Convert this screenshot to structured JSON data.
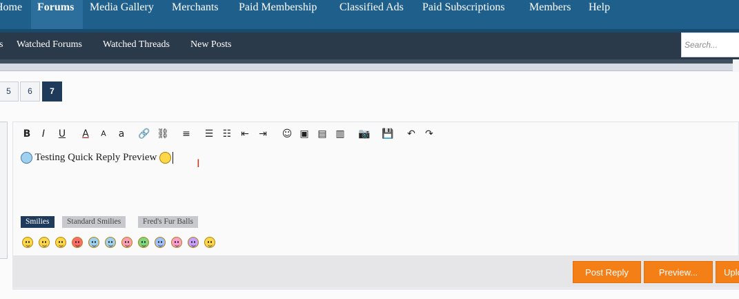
{
  "topnav": {
    "items": [
      "Home",
      "Forums",
      "Media Gallery",
      "Merchants",
      "Paid Membership",
      "Classified Ads",
      "Paid Subscriptions",
      "Members",
      "Help"
    ],
    "active_index": 1
  },
  "subnav": {
    "items": [
      "s",
      "Watched Forums",
      "Watched Threads",
      "New Posts"
    ],
    "search_placeholder": "Search..."
  },
  "pager": {
    "pages": [
      "5",
      "6",
      "7"
    ],
    "current": "7"
  },
  "editor": {
    "toolbar": [
      {
        "name": "bold-icon",
        "glyph": "B"
      },
      {
        "name": "italic-icon",
        "glyph": "I"
      },
      {
        "name": "underline-icon",
        "glyph": "U"
      },
      {
        "name": "font-color-icon",
        "glyph": "A"
      },
      {
        "name": "font-size-icon",
        "glyph": "A"
      },
      {
        "name": "font-family-icon",
        "glyph": "a"
      },
      {
        "name": "link-icon",
        "glyph": "🔗"
      },
      {
        "name": "unlink-icon",
        "glyph": "⛓"
      },
      {
        "name": "align-icon",
        "glyph": "≡"
      },
      {
        "name": "bullet-list-icon",
        "glyph": "☰"
      },
      {
        "name": "numbered-list-icon",
        "glyph": "☷"
      },
      {
        "name": "outdent-icon",
        "glyph": "⇤"
      },
      {
        "name": "indent-icon",
        "glyph": "⇥"
      },
      {
        "name": "smilie-icon",
        "glyph": "☺"
      },
      {
        "name": "image-icon",
        "glyph": "▣"
      },
      {
        "name": "media-icon",
        "glyph": "▤"
      },
      {
        "name": "template-icon",
        "glyph": "▥"
      },
      {
        "name": "camera-icon",
        "glyph": "📷"
      },
      {
        "name": "save-draft-icon",
        "glyph": "💾"
      },
      {
        "name": "undo-icon",
        "glyph": "↶"
      },
      {
        "name": "redo-icon",
        "glyph": "↷"
      }
    ],
    "content_text": "Testing Quick Reply Preview",
    "smilie_tabs": [
      "Smilies",
      "Standard Smilies",
      "Fred's Fur Balls"
    ],
    "smilie_colors": [
      "#ffd84a",
      "#ffd84a",
      "#ffd84a",
      "#ff6b6b",
      "#9ed0f0",
      "#9ed0f0",
      "#ff9fb3",
      "#7fd77f",
      "#9fc0ff",
      "#ff9fd0",
      "#c8a0ff",
      "#ffd84a"
    ]
  },
  "buttons": {
    "post_reply": "Post Reply",
    "preview": "Preview...",
    "upload": "Upload"
  }
}
